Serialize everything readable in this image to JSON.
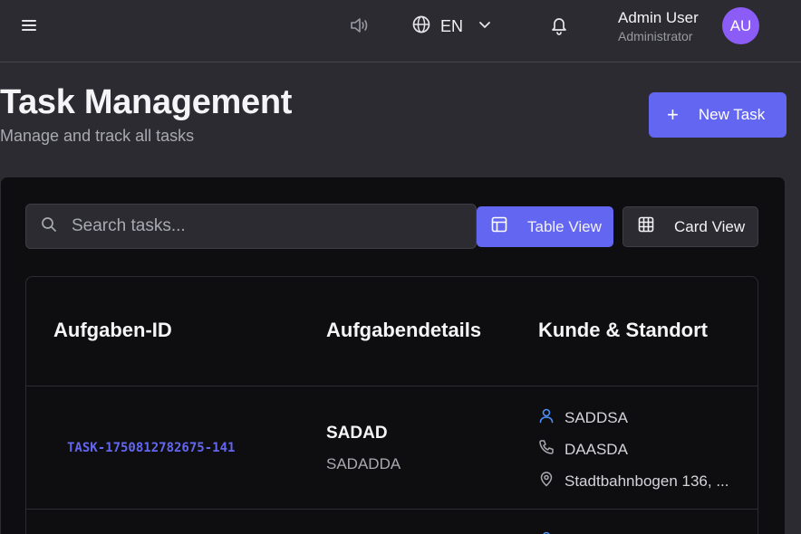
{
  "header": {
    "language_code": "EN",
    "user_name": "Admin User",
    "user_role": "Administrator",
    "avatar_initials": "AU",
    "icons": [
      "menu-icon",
      "speaker-icon",
      "globe-icon",
      "chevron-down-icon",
      "bell-icon"
    ]
  },
  "page": {
    "title": "Task Management",
    "subtitle": "Manage and track all tasks",
    "new_task_label": "New Task"
  },
  "toolbar": {
    "search_placeholder": "Search tasks...",
    "table_view_label": "Table View",
    "card_view_label": "Card View"
  },
  "table": {
    "columns": [
      "Aufgaben-ID",
      "Aufgabendetails",
      "Kunde & Standort"
    ],
    "rows": [
      {
        "id": "TASK-1750812782675-141",
        "title": "SADAD",
        "description": "SADADDA",
        "customer": "SADDSA",
        "phone": "DAASDA",
        "address": "Stadtbahnbogen 136, ..."
      }
    ]
  },
  "colors": {
    "accent": "#6366f1",
    "avatar": "#8b5cf6",
    "background": "#2b2b31",
    "card": "#0e0e10",
    "customer_icon": "#4f8ff7"
  }
}
